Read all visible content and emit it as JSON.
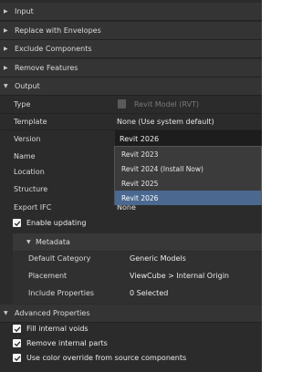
{
  "sections": {
    "input": "Input",
    "replace": "Replace with Envelopes",
    "exclude": "Exclude Components",
    "remove": "Remove Features",
    "output": "Output",
    "advanced": "Advanced Properties"
  },
  "output": {
    "type": {
      "label": "Type",
      "value": "Revit Model (RVT)"
    },
    "template": {
      "label": "Template",
      "value": "None (Use system default)"
    },
    "version": {
      "label": "Version",
      "value": "Revit 2026"
    },
    "name": {
      "label": "Name"
    },
    "location": {
      "label": "Location"
    },
    "structure": {
      "label": "Structure"
    },
    "export_ifc": {
      "label": "Export IFC",
      "value": "None"
    },
    "enable_updating": {
      "label": "Enable updating",
      "checked": true
    }
  },
  "version_dropdown": {
    "options": [
      "Revit 2023",
      "Revit 2024 (Install Now)",
      "Revit 2025",
      "Revit 2026"
    ],
    "selected": "Revit 2026"
  },
  "metadata": {
    "header": "Metadata",
    "default_category": {
      "label": "Default Category",
      "value": "Generic Models"
    },
    "placement": {
      "label": "Placement",
      "value": "ViewCube > Internal Origin"
    },
    "include_properties": {
      "label": "Include Properties",
      "value": "0 Selected"
    }
  },
  "advanced": {
    "fill_voids": "Fill internal voids",
    "remove_parts": "Remove internal parts",
    "color_override": "Use color override from source components"
  },
  "colors": {
    "panel": "#2b2b2b",
    "header": "#343434",
    "selection": "#4a6890",
    "combo": "#1d1d1d"
  },
  "icons": {
    "collapsed": "triangle-right",
    "expanded": "triangle-down",
    "type": "revit-file-icon",
    "check": "checkmark-icon"
  }
}
